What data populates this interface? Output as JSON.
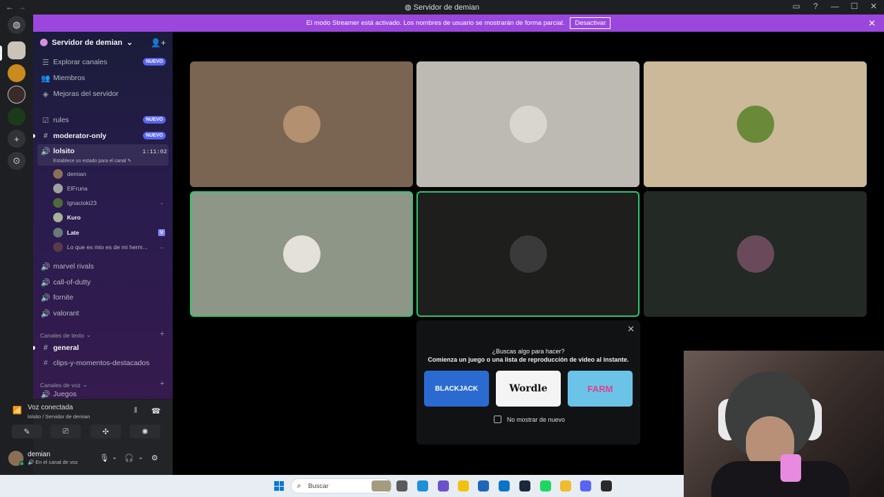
{
  "window": {
    "title": "Servidor de demian",
    "nav_back": "←",
    "nav_forward": "→",
    "controls": [
      "▭",
      "?",
      "—",
      "☐",
      "✕"
    ]
  },
  "banner": {
    "text": "El modo Streamer está activado. Los nombres de usuario se mostrarán de forma parcial.",
    "button": "Desactivar",
    "close": "✕"
  },
  "server": {
    "name": "Servidor de demian",
    "chevron": "⌄",
    "add_member_icon": "👤+"
  },
  "sidebar": {
    "top_items": [
      {
        "icon": "☰",
        "label": "Explorar canales",
        "badge": "NUEVO"
      },
      {
        "icon": "👥",
        "label": "Miembros",
        "badge": ""
      },
      {
        "icon": "◈",
        "label": "Mejoras del servidor",
        "badge": ""
      }
    ],
    "channels": [
      {
        "icon": "☑",
        "label": "rules",
        "badge": "NUEVO"
      },
      {
        "icon": "#",
        "label": "moderator-only",
        "badge": "NUEVO"
      }
    ],
    "active_voice": {
      "icon": "🔊",
      "label": "lolsito",
      "time": "1:11:02",
      "status": "Establece un estado para el canal ✎"
    },
    "voice_users": [
      {
        "name": "demian",
        "bold": false,
        "badge": "",
        "avatar_color": "#8a6f57"
      },
      {
        "name": "ElFruna",
        "bold": false,
        "badge": "",
        "avatar_color": "#a0a0a0"
      },
      {
        "name": "Ignacioki23",
        "bold": false,
        "badge": "⌄",
        "avatar_color": "#4f6a3a"
      },
      {
        "name": "Kuro",
        "bold": true,
        "badge": "",
        "avatar_color": "#a8b0a0"
      },
      {
        "name": "Late",
        "bold": true,
        "badge": "V",
        "avatar_color": "#6a7a7a"
      },
      {
        "name": "Lo que es mio es de mi herm...",
        "bold": false,
        "badge": "⌄",
        "avatar_color": "#5a3a4a"
      }
    ],
    "other_voice": [
      "marvel rivals",
      "call-of-dutty",
      "fornite",
      "valorant"
    ],
    "text_category": "Canales de texto",
    "text_channels": [
      {
        "label": "general",
        "bold": true
      },
      {
        "label": "clips-y-momentos-destacados",
        "bold": false
      }
    ],
    "voice_category": "Canales de voz",
    "voice_partial": "Juegos"
  },
  "voice_panel": {
    "title": "Voz conectada",
    "subtitle": "lolsito / Servidor de demian",
    "buttons": [
      "✎",
      "⎚",
      "✣",
      "✺"
    ]
  },
  "user_panel": {
    "name": "demian",
    "status": "🔊 En el canal de voz",
    "controls": [
      "🎙",
      "⌄",
      "🎧",
      "⌄",
      "⚙"
    ]
  },
  "tiles": [
    {
      "bg": "#7a6452",
      "avatar": "#b29070",
      "speaking": false
    },
    {
      "bg": "#bdbab3",
      "avatar": "#d9d6d0",
      "speaking": false
    },
    {
      "bg": "#cbb999",
      "avatar": "#6a8a3a",
      "speaking": false
    },
    {
      "bg": "#8e9787",
      "avatar": "#e4e0da",
      "speaking": true
    },
    {
      "bg": "#1e1f1d",
      "avatar": "#3a3a3a",
      "speaking": true
    },
    {
      "bg": "#232925",
      "avatar": "#6a4a5a",
      "speaking": false
    }
  ],
  "activity": {
    "close": "✕",
    "question": "¿Buscas algo para hacer?",
    "subtitle": "Comienza un juego o una lista de reproducción de video al instante.",
    "games": [
      {
        "label": "BLACKJACK",
        "bg": "#2b6bd1",
        "color": "#ffffff"
      },
      {
        "label": "Wordle",
        "bg": "#f4f4f4",
        "color": "#111111"
      },
      {
        "label": "FARM",
        "bg": "#6cc3e8",
        "color": "#e0428a"
      }
    ],
    "checkbox_label": "No mostrar de nuevo"
  },
  "taskbar": {
    "search_placeholder": "Buscar",
    "search_icon": "⌕",
    "apps": [
      "#a59b80",
      "#5a5a5a",
      "#1d8fd8",
      "#6b52c8",
      "#f2c30e",
      "#1e66b8",
      "#0b74c8",
      "#1b2838",
      "#1ed760",
      "#f0bc2b",
      "#5865f2",
      "#2a2a2a"
    ]
  },
  "colors": {
    "accent": "#5865f2",
    "banner": "#9b47de",
    "speaking": "#2dc770"
  }
}
